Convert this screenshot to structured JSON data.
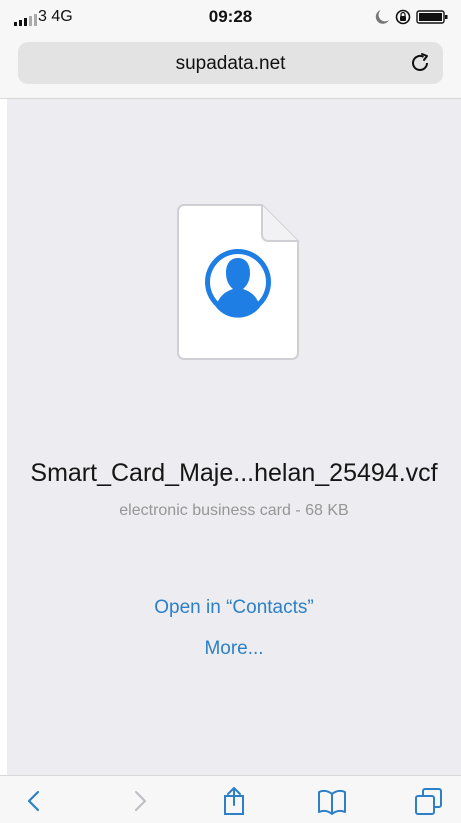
{
  "status_bar": {
    "carrier": "3  4G",
    "time": "09:28"
  },
  "browser": {
    "url": "supadata.net"
  },
  "download": {
    "file_name": "Smart_Card_Maje...helan_25494.vcf",
    "meta": "electronic business card - 68 KB",
    "open_link": "Open in “Contacts”",
    "more_link": "More..."
  },
  "icons": {
    "signal": "signal-icon",
    "moon": "moon-icon",
    "rotation_lock": "rotation-lock-icon",
    "battery": "battery-icon",
    "reload": "reload-icon",
    "file": "contact-card-file-icon",
    "back": "back-icon",
    "forward": "forward-icon",
    "share": "share-icon",
    "bookmarks": "bookmarks-icon",
    "tabs": "tabs-icon"
  },
  "colors": {
    "link": "#2d80c8",
    "avatar_blue": "#1f7ee3",
    "background": "#ececf1"
  }
}
